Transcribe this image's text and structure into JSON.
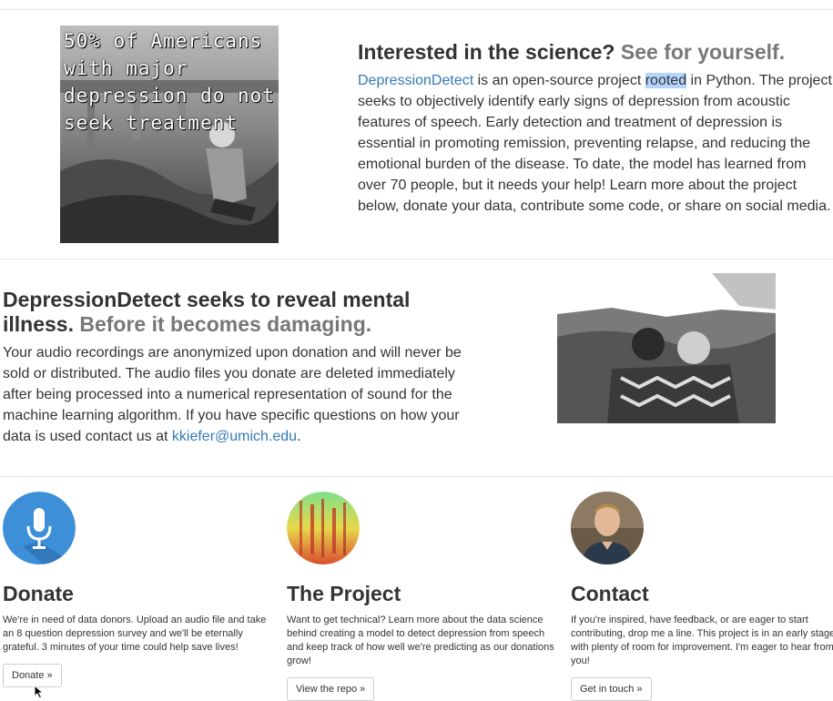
{
  "section1": {
    "image_caption_lines": [
      "50% of Americans",
      "with major",
      "depression do not",
      "seek treatment"
    ],
    "heading_main": "Interested in the science?",
    "heading_muted": "See for yourself.",
    "link_text": "DepressionDetect",
    "text_a": " is an open-source project ",
    "text_highlight": "rooted",
    "text_b": " in Python. The project seeks to objectively identify early signs of depression from acoustic features of speech. Early detection and treatment of depression is essential in promoting remission, preventing relapse, and reducing the emotional burden of the disease. To date, the model has learned from over 70 people, but it needs your help! Learn more about the project below, donate your data, contribute some code, or share on social media."
  },
  "section2": {
    "heading_main": "DepressionDetect seeks to reveal mental illness.",
    "heading_muted": "Before it becomes damaging.",
    "text_a": "Your audio recordings are anonymized upon donation and will never be sold or distributed. The audio files you donate are deleted immediately after being processed into a numerical representation of sound for the machine learning algorithm. If you have specific questions on how your data is used contact us at ",
    "email": "kkiefer@umich.edu",
    "text_end": "."
  },
  "columns": [
    {
      "icon": "microphone-icon",
      "title": "Donate",
      "text": "We're in need of data donors. Upload an audio file and take an 8 question depression survey and we'll be eternally grateful. 3 minutes of your time could help save lives!",
      "button": "Donate »"
    },
    {
      "icon": "spectrogram-icon",
      "title": "The Project",
      "text": "Want to get technical? Learn more about the data science behind creating a model to detect depression from speech and keep track of how well we're predicting as our donations grow!",
      "button": "View the repo »"
    },
    {
      "icon": "profile-photo",
      "title": "Contact",
      "text": "If you're inspired, have feedback, or are eager to start contributing, drop me a line. This project is in an early stage with plenty of room for improvement. I'm eager to hear from you!",
      "button": "Get in touch »"
    }
  ],
  "colors": {
    "link": "#337ab7",
    "muted": "#777777",
    "donate_icon_bg": "#3d8fd8"
  }
}
